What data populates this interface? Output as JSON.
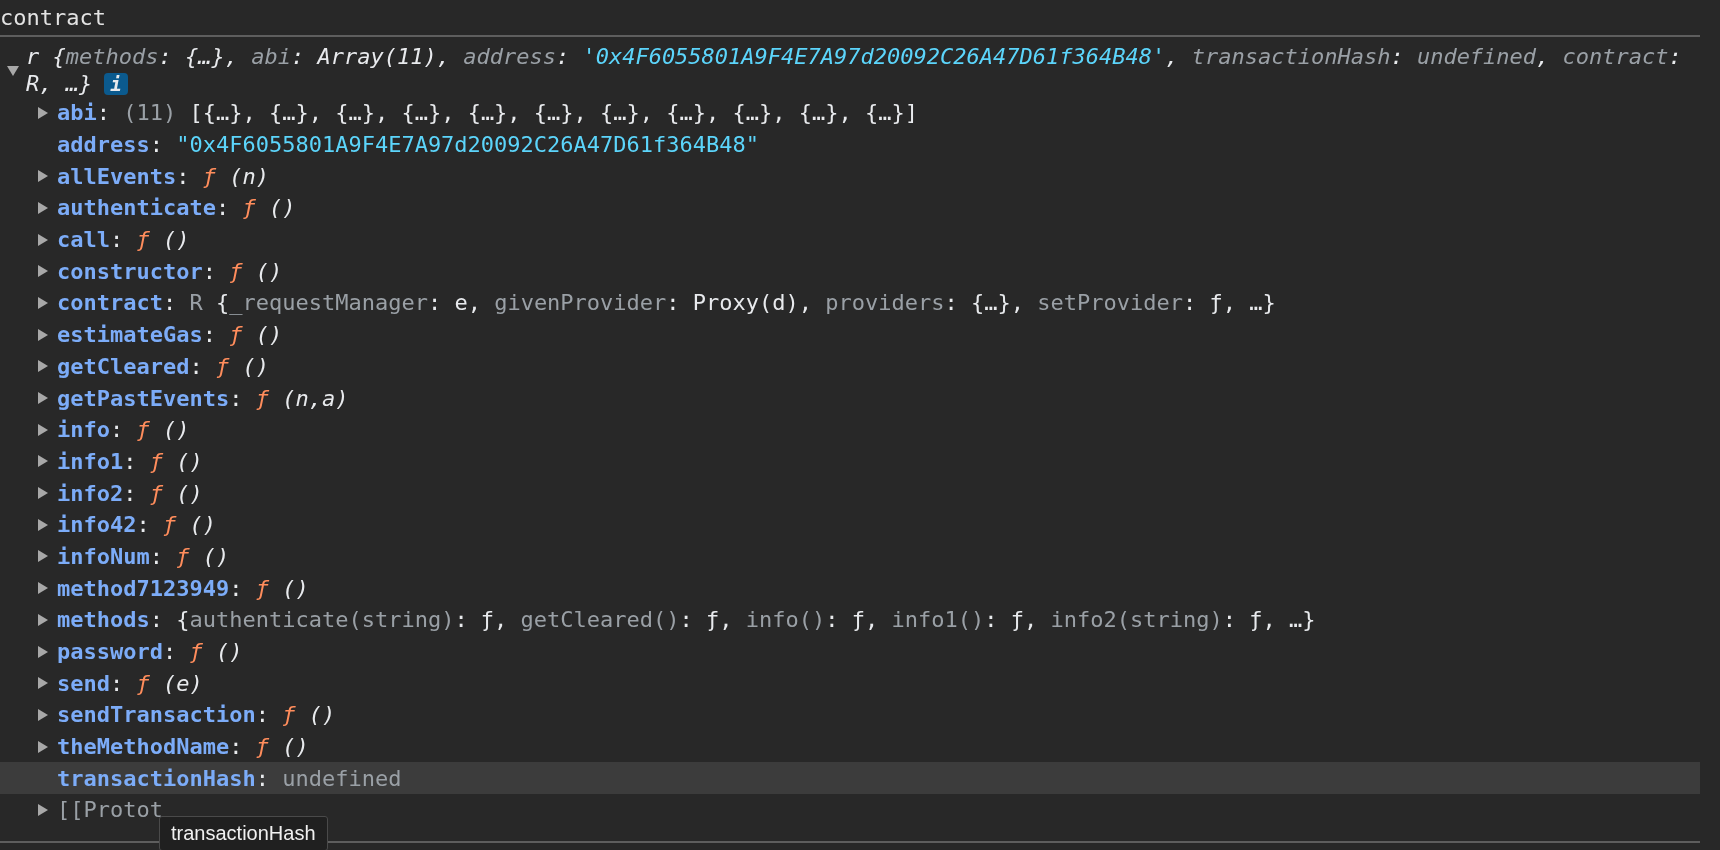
{
  "header": {
    "title": "contract"
  },
  "summary": {
    "expanded": true,
    "badge": "i",
    "lines": [
      [
        {
          "t": "r {",
          "kind": "plain"
        },
        {
          "t": "methods",
          "kind": "key"
        },
        {
          "t": ": ",
          "kind": "plain"
        },
        {
          "t": "{…}",
          "kind": "plain"
        },
        {
          "t": ", ",
          "kind": "plain"
        },
        {
          "t": "abi",
          "kind": "key"
        },
        {
          "t": ": ",
          "kind": "plain"
        },
        {
          "t": "Array(11)",
          "kind": "plain"
        },
        {
          "t": ", ",
          "kind": "plain"
        },
        {
          "t": "address",
          "kind": "key"
        },
        {
          "t": ": ",
          "kind": "plain"
        },
        {
          "t": "'0x4F6055801A9F4E7A97d20092C26A47D61f364B48'",
          "kind": "string"
        },
        {
          "t": ", ",
          "kind": "plain"
        },
        {
          "t": "transactionHash",
          "kind": "key"
        },
        {
          "t": ": ",
          "kind": "plain"
        },
        {
          "t": "undefined",
          "kind": "dim"
        },
        {
          "t": ", ",
          "kind": "plain"
        },
        {
          "t": "contract",
          "kind": "key"
        },
        {
          "t": ":",
          "kind": "plain"
        }
      ],
      [
        {
          "t": "R, …}",
          "kind": "plain"
        }
      ]
    ]
  },
  "rows": [
    {
      "expandable": true,
      "highlighted": false,
      "tokens": [
        {
          "t": "abi",
          "kind": "name"
        },
        {
          "t": ": ",
          "kind": "plain"
        },
        {
          "t": "(11) ",
          "kind": "dim"
        },
        {
          "t": "[{…}, {…}, {…}, {…}, {…}, {…}, {…}, {…}, {…}, {…}, {…}]",
          "kind": "plain"
        }
      ]
    },
    {
      "expandable": false,
      "highlighted": false,
      "tokens": [
        {
          "t": "address",
          "kind": "name"
        },
        {
          "t": ": ",
          "kind": "plain"
        },
        {
          "t": "\"0x4F6055801A9F4E7A97d20092C26A47D61f364B48\"",
          "kind": "string"
        }
      ]
    },
    {
      "expandable": true,
      "highlighted": false,
      "tokens": [
        {
          "t": "allEvents",
          "kind": "name"
        },
        {
          "t": ": ",
          "kind": "plain"
        },
        {
          "t": "ƒ",
          "kind": "fn"
        },
        {
          "t": " (n)",
          "kind": "args"
        }
      ]
    },
    {
      "expandable": true,
      "highlighted": false,
      "tokens": [
        {
          "t": "authenticate",
          "kind": "name"
        },
        {
          "t": ": ",
          "kind": "plain"
        },
        {
          "t": "ƒ",
          "kind": "fn"
        },
        {
          "t": " ()",
          "kind": "args"
        }
      ]
    },
    {
      "expandable": true,
      "highlighted": false,
      "tokens": [
        {
          "t": "call",
          "kind": "name"
        },
        {
          "t": ": ",
          "kind": "plain"
        },
        {
          "t": "ƒ",
          "kind": "fn"
        },
        {
          "t": " ()",
          "kind": "args"
        }
      ]
    },
    {
      "expandable": true,
      "highlighted": false,
      "tokens": [
        {
          "t": "constructor",
          "kind": "name"
        },
        {
          "t": ": ",
          "kind": "plain"
        },
        {
          "t": "ƒ",
          "kind": "fn"
        },
        {
          "t": " ()",
          "kind": "args"
        }
      ]
    },
    {
      "expandable": true,
      "highlighted": false,
      "tokens": [
        {
          "t": "contract",
          "kind": "name"
        },
        {
          "t": ": ",
          "kind": "plain"
        },
        {
          "t": "R ",
          "kind": "dim"
        },
        {
          "t": "{",
          "kind": "plain"
        },
        {
          "t": "_requestManager",
          "kind": "key"
        },
        {
          "t": ": e, ",
          "kind": "plain"
        },
        {
          "t": "givenProvider",
          "kind": "key"
        },
        {
          "t": ": Proxy(d), ",
          "kind": "plain"
        },
        {
          "t": "providers",
          "kind": "key"
        },
        {
          "t": ": {…}, ",
          "kind": "plain"
        },
        {
          "t": "setProvider",
          "kind": "key"
        },
        {
          "t": ": ƒ, …}",
          "kind": "plain"
        }
      ]
    },
    {
      "expandable": true,
      "highlighted": false,
      "tokens": [
        {
          "t": "estimateGas",
          "kind": "name"
        },
        {
          "t": ": ",
          "kind": "plain"
        },
        {
          "t": "ƒ",
          "kind": "fn"
        },
        {
          "t": " ()",
          "kind": "args"
        }
      ]
    },
    {
      "expandable": true,
      "highlighted": false,
      "tokens": [
        {
          "t": "getCleared",
          "kind": "name"
        },
        {
          "t": ": ",
          "kind": "plain"
        },
        {
          "t": "ƒ",
          "kind": "fn"
        },
        {
          "t": " ()",
          "kind": "args"
        }
      ]
    },
    {
      "expandable": true,
      "highlighted": false,
      "tokens": [
        {
          "t": "getPastEvents",
          "kind": "name"
        },
        {
          "t": ": ",
          "kind": "plain"
        },
        {
          "t": "ƒ",
          "kind": "fn"
        },
        {
          "t": " (n,a)",
          "kind": "args"
        }
      ]
    },
    {
      "expandable": true,
      "highlighted": false,
      "tokens": [
        {
          "t": "info",
          "kind": "name"
        },
        {
          "t": ": ",
          "kind": "plain"
        },
        {
          "t": "ƒ",
          "kind": "fn"
        },
        {
          "t": " ()",
          "kind": "args"
        }
      ]
    },
    {
      "expandable": true,
      "highlighted": false,
      "tokens": [
        {
          "t": "info1",
          "kind": "name"
        },
        {
          "t": ": ",
          "kind": "plain"
        },
        {
          "t": "ƒ",
          "kind": "fn"
        },
        {
          "t": " ()",
          "kind": "args"
        }
      ]
    },
    {
      "expandable": true,
      "highlighted": false,
      "tokens": [
        {
          "t": "info2",
          "kind": "name"
        },
        {
          "t": ": ",
          "kind": "plain"
        },
        {
          "t": "ƒ",
          "kind": "fn"
        },
        {
          "t": " ()",
          "kind": "args"
        }
      ]
    },
    {
      "expandable": true,
      "highlighted": false,
      "tokens": [
        {
          "t": "info42",
          "kind": "name"
        },
        {
          "t": ": ",
          "kind": "plain"
        },
        {
          "t": "ƒ",
          "kind": "fn"
        },
        {
          "t": " ()",
          "kind": "args"
        }
      ]
    },
    {
      "expandable": true,
      "highlighted": false,
      "tokens": [
        {
          "t": "infoNum",
          "kind": "name"
        },
        {
          "t": ": ",
          "kind": "plain"
        },
        {
          "t": "ƒ",
          "kind": "fn"
        },
        {
          "t": " ()",
          "kind": "args"
        }
      ]
    },
    {
      "expandable": true,
      "highlighted": false,
      "tokens": [
        {
          "t": "method7123949",
          "kind": "name"
        },
        {
          "t": ": ",
          "kind": "plain"
        },
        {
          "t": "ƒ",
          "kind": "fn"
        },
        {
          "t": " ()",
          "kind": "args"
        }
      ]
    },
    {
      "expandable": true,
      "highlighted": false,
      "tokens": [
        {
          "t": "methods",
          "kind": "name"
        },
        {
          "t": ": {",
          "kind": "plain"
        },
        {
          "t": "authenticate(string)",
          "kind": "key"
        },
        {
          "t": ": ƒ, ",
          "kind": "plain"
        },
        {
          "t": "getCleared()",
          "kind": "key"
        },
        {
          "t": ": ƒ, ",
          "kind": "plain"
        },
        {
          "t": "info()",
          "kind": "key"
        },
        {
          "t": ": ƒ, ",
          "kind": "plain"
        },
        {
          "t": "info1()",
          "kind": "key"
        },
        {
          "t": ": ƒ, ",
          "kind": "plain"
        },
        {
          "t": "info2(string)",
          "kind": "key"
        },
        {
          "t": ": ƒ, …}",
          "kind": "plain"
        }
      ]
    },
    {
      "expandable": true,
      "highlighted": false,
      "tokens": [
        {
          "t": "password",
          "kind": "name"
        },
        {
          "t": ": ",
          "kind": "plain"
        },
        {
          "t": "ƒ",
          "kind": "fn"
        },
        {
          "t": " ()",
          "kind": "args"
        }
      ]
    },
    {
      "expandable": true,
      "highlighted": false,
      "tokens": [
        {
          "t": "send",
          "kind": "name"
        },
        {
          "t": ": ",
          "kind": "plain"
        },
        {
          "t": "ƒ",
          "kind": "fn"
        },
        {
          "t": " (e)",
          "kind": "args"
        }
      ]
    },
    {
      "expandable": true,
      "highlighted": false,
      "tokens": [
        {
          "t": "sendTransaction",
          "kind": "name"
        },
        {
          "t": ": ",
          "kind": "plain"
        },
        {
          "t": "ƒ",
          "kind": "fn"
        },
        {
          "t": " ()",
          "kind": "args"
        }
      ]
    },
    {
      "expandable": true,
      "highlighted": false,
      "tokens": [
        {
          "t": "theMethodName",
          "kind": "name"
        },
        {
          "t": ": ",
          "kind": "plain"
        },
        {
          "t": "ƒ",
          "kind": "fn"
        },
        {
          "t": " ()",
          "kind": "args"
        }
      ]
    },
    {
      "expandable": false,
      "highlighted": true,
      "tokens": [
        {
          "t": "transactionHash",
          "kind": "name"
        },
        {
          "t": ": ",
          "kind": "plain"
        },
        {
          "t": "undefined",
          "kind": "dim"
        }
      ]
    },
    {
      "expandable": true,
      "highlighted": false,
      "tokens": [
        {
          "t": "[[Protot",
          "kind": "dim"
        }
      ],
      "tooltip": "transactionHash"
    }
  ]
}
